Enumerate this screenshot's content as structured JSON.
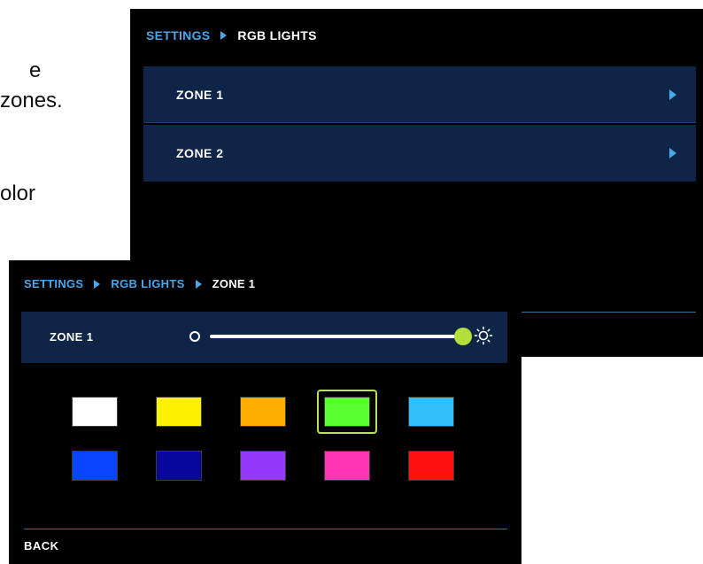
{
  "background_text": {
    "line1": "e",
    "line2": "zones.",
    "line3": "olor"
  },
  "zones_screen": {
    "breadcrumb": [
      {
        "label": "SETTINGS",
        "current": false
      },
      {
        "label": "RGB LIGHTS",
        "current": true
      }
    ],
    "zones": [
      {
        "label": "ZONE 1"
      },
      {
        "label": "ZONE 2"
      }
    ]
  },
  "zone1_screen": {
    "breadcrumb": [
      {
        "label": "SETTINGS",
        "current": false
      },
      {
        "label": "RGB LIGHTS",
        "current": false
      },
      {
        "label": "ZONE 1",
        "current": true
      }
    ],
    "zone_label": "ZONE 1",
    "brightness_percent": 100,
    "icons": {
      "dim": "dim-brightness-icon",
      "bright": "bright-brightness-icon"
    },
    "colors": [
      {
        "name": "white",
        "hex": "#ffffff"
      },
      {
        "name": "yellow",
        "hex": "#fff200"
      },
      {
        "name": "orange",
        "hex": "#ffae00"
      },
      {
        "name": "green",
        "hex": "#58ff2e"
      },
      {
        "name": "light-blue",
        "hex": "#30bff8"
      },
      {
        "name": "blue",
        "hex": "#0a44ff"
      },
      {
        "name": "navy",
        "hex": "#07079e"
      },
      {
        "name": "purple",
        "hex": "#9438fe"
      },
      {
        "name": "pink",
        "hex": "#ff35b6"
      },
      {
        "name": "red",
        "hex": "#ff1111"
      }
    ],
    "selected_color_index": 3,
    "back_label": "BACK"
  },
  "theme": {
    "accent": "#4ba6e8",
    "panel": "#0e2548",
    "selection": "#b7e25a"
  }
}
